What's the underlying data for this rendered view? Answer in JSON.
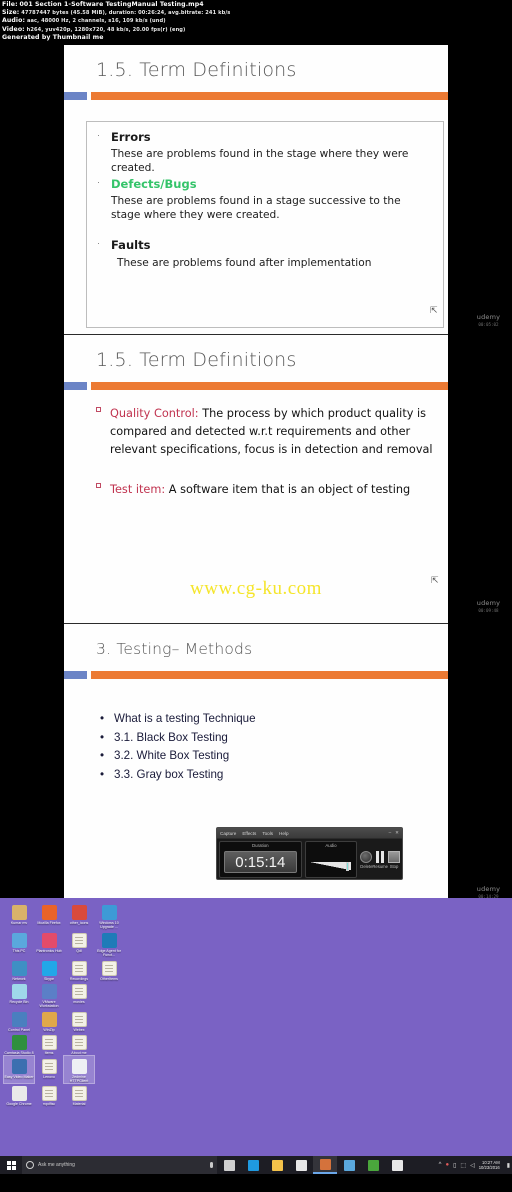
{
  "mediainfo": {
    "file_label": "File:",
    "file_value": "001 Section 1-Software TestingManual Testing.mp4",
    "size_label": "Size:",
    "size_value": "47787447 bytes (45.58 MiB), duration: 00:26:24, avg.bitrate: 241 kb/s",
    "audio_label": "Audio:",
    "audio_value": "aac, 48000 Hz, 2 channels, s16, 109 kb/s (und)",
    "video_label": "Video:",
    "video_value": "h264, yuv420p, 1280x720, 48 kb/s, 20.00 fps(r) (eng)",
    "generator": "Generated by Thumbnail me"
  },
  "slides": [
    {
      "title": "1.5. Term Definitions",
      "blocks": [
        {
          "bullet": "·",
          "head": "Errors",
          "head_color": "dark",
          "body": "These are problems found in the stage where they were created."
        },
        {
          "bullet": "·",
          "head": "Defects/Bugs",
          "head_color": "green",
          "body": "These are problems found in a stage successive to the stage where they were created."
        },
        {
          "bullet": "·",
          "head": "Faults",
          "head_color": "dark",
          "body": "These are problems found after implementation"
        }
      ],
      "timestamp": "00:05:02"
    },
    {
      "title": "1.5. Term Definitions",
      "items": [
        {
          "term": "Quality Control",
          "sep": ":",
          "text": " The process by which product quality is compared and detected w.r.t requirements and other relevant specifications, focus is in detection and removal"
        },
        {
          "term": "Test item",
          "sep": ":",
          "text": " A software item that is an object of testing"
        }
      ],
      "watermark_site": "www.cg-ku.com",
      "timestamp": "00:09:48"
    },
    {
      "title": "3. Testing– Methods",
      "list": [
        "What is a testing Technique",
        "3.1. Black Box Testing",
        "3.2. White Box Testing",
        "3.3. Gray box Testing"
      ],
      "timestamp": "00:14:29"
    }
  ],
  "watermark_brand": "udemy",
  "recorder": {
    "menu": [
      "Capture",
      "Effects",
      "Tools",
      "Help"
    ],
    "minimize": "–",
    "close": "✕",
    "duration_label": "Duration",
    "duration_value": "0:15:14",
    "audio_label": "Audio",
    "buttons": [
      {
        "label": "Delete",
        "icon": "record-circle-icon"
      },
      {
        "label": "Resume",
        "icon": "pause-icon"
      },
      {
        "label": "Stop",
        "icon": "stop-square-icon"
      }
    ]
  },
  "desktop": {
    "background": "#7a62c4",
    "icons": [
      {
        "label": "Kumar mv",
        "type": "app",
        "color": "#d9b26a"
      },
      {
        "label": "Mozilla Firefox",
        "type": "app",
        "color": "#e9632a"
      },
      {
        "label": "other_icons",
        "type": "app",
        "color": "#d94a3c"
      },
      {
        "label": "Windows 10 Upgrade ...",
        "type": "app",
        "color": "#3d9ad6"
      },
      {
        "label": "This PC",
        "type": "app",
        "color": "#5aa8dd"
      },
      {
        "label": "Plantronics Hub",
        "type": "app",
        "color": "#e34b6a"
      },
      {
        "label": "Qdl",
        "type": "doc",
        "color": "#f3f1e7"
      },
      {
        "label": "Edge Agent for Funct...",
        "type": "app",
        "color": "#1f7bb8"
      },
      {
        "label": "Network",
        "type": "app",
        "color": "#3e8fc4"
      },
      {
        "label": "Skype",
        "type": "app",
        "color": "#22a7e8"
      },
      {
        "label": "Recordings",
        "type": "doc",
        "color": "#f3f1e7"
      },
      {
        "label": "OtherItems",
        "type": "doc",
        "color": "#f3f1e7"
      },
      {
        "label": "Recycle Bin",
        "type": "app",
        "color": "#9fd8ea"
      },
      {
        "label": "VMware Workstation",
        "type": "app",
        "color": "#5b7fc7"
      },
      {
        "label": "movies",
        "type": "doc",
        "color": "#f3f1e7"
      },
      {
        "label": "",
        "type": "none",
        "color": "transparent"
      },
      {
        "label": "Control Panel",
        "type": "app",
        "color": "#4a7fbf"
      },
      {
        "label": "WinZip",
        "type": "app",
        "color": "#e0a84b"
      },
      {
        "label": "Webex",
        "type": "doc",
        "color": "#f3f1e7"
      },
      {
        "label": "",
        "type": "none",
        "color": "transparent"
      },
      {
        "label": "Camtasia Studio 8",
        "type": "app",
        "color": "#2f8f3e"
      },
      {
        "label": "Items",
        "type": "doc",
        "color": "#f3f1e7"
      },
      {
        "label": "About me",
        "type": "doc",
        "color": "#eef0f4"
      },
      {
        "label": "",
        "type": "none",
        "color": "transparent"
      },
      {
        "label": "Easy Video Maker",
        "type": "app",
        "color": "#3c6fb0",
        "selected": true
      },
      {
        "label": "Lenovo",
        "type": "doc",
        "color": "#f3f1e7"
      },
      {
        "label": "2edmine HTTPClient",
        "type": "app",
        "color": "#eef0f4",
        "selected": true
      },
      {
        "label": "",
        "type": "none",
        "color": "transparent"
      },
      {
        "label": "Google Chrome",
        "type": "app",
        "color": "#e9e9e9"
      },
      {
        "label": "mpdfisc",
        "type": "doc",
        "color": "#f3f1e7"
      },
      {
        "label": "Material",
        "type": "doc",
        "color": "#f3f1e7"
      },
      {
        "label": "",
        "type": "none",
        "color": "transparent"
      }
    ]
  },
  "taskbar": {
    "start_icon": "windows-logo-icon",
    "search_placeholder": "Ask me anything",
    "search_icon": "cortana-circle-icon",
    "mic_icon": "microphone-icon",
    "apps": [
      {
        "name": "task-view-icon",
        "color": "#cfcfcf"
      },
      {
        "name": "edge-browser-icon",
        "color": "#1f9ae0"
      },
      {
        "name": "file-explorer-icon",
        "color": "#f4c24a"
      },
      {
        "name": "store-icon",
        "color": "#e8e8e8"
      },
      {
        "name": "photo-app-icon",
        "color": "#d4723c",
        "active": true
      },
      {
        "name": "remote-desktop-icon",
        "color": "#5aa8dd"
      },
      {
        "name": "camtasia-icon",
        "color": "#4aa63c"
      },
      {
        "name": "camtasia-recorder-icon",
        "color": "#e8e8e8"
      }
    ],
    "tray": [
      "∧",
      "●",
      "▭",
      "⬚",
      "◁"
    ],
    "clock_time": "10:27 AM",
    "clock_date": "10/23/2016"
  }
}
